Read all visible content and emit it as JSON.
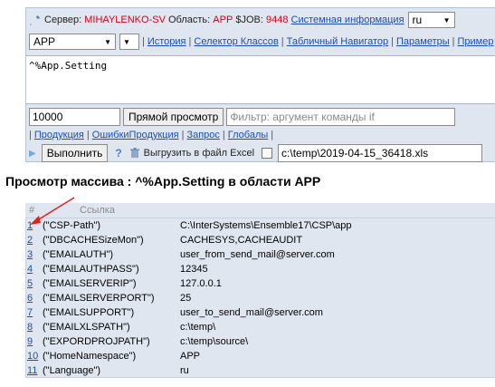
{
  "header": {
    "server_label": "Сервер:",
    "server_value": "MIHAYLENKO-SV",
    "area_label": "Область:",
    "area_value": "APP",
    "job_label": "$JOB:",
    "job_value": "9448",
    "sysinfo_link": "Системная информация",
    "lang_value": "ru"
  },
  "nav": {
    "namespace_value": "APP",
    "sep": "|",
    "links": [
      "История",
      "Селектор Классов",
      "Табличный Навигатор",
      "Параметры",
      "Пример"
    ]
  },
  "code": {
    "text": "^%App.Setting"
  },
  "controls": {
    "count_value": "10000",
    "direct_view_label": "Прямой просмотр",
    "filter_placeholder": "Фильтр: аргумент команды if"
  },
  "links2": [
    "Продукция",
    "ОшибкиПродукция",
    "Запрос",
    "Глобалы"
  ],
  "exec": {
    "execute_label": "Выполнить",
    "help_glyph": "?",
    "export_label": "Выгрузить в файл Excel",
    "file_path": "c:\\temp\\2019-04-15_36418.xls"
  },
  "page": {
    "title": "Просмотр массива : ^%App.Setting в области APP"
  },
  "table": {
    "col_num": "#",
    "col_ref": "Ссылка",
    "rows": [
      {
        "n": "1",
        "key": "(\"CSP-Path\")",
        "val": "C:\\InterSystems\\Ensemble17\\CSP\\app"
      },
      {
        "n": "2",
        "key": "(\"DBCACHESizeMon\")",
        "val": "CACHESYS,CACHEAUDIT"
      },
      {
        "n": "3",
        "key": "(\"EMAILAUTH\")",
        "val": "user_from_send_mail@server.com"
      },
      {
        "n": "4",
        "key": "(\"EMAILAUTHPASS\")",
        "val": "12345"
      },
      {
        "n": "5",
        "key": "(\"EMAILSERVERIP\")",
        "val": "127.0.0.1"
      },
      {
        "n": "6",
        "key": "(\"EMAILSERVERPORT\")",
        "val": "25"
      },
      {
        "n": "7",
        "key": "(\"EMAILSUPPORT\")",
        "val": "user_to_send_mail@server.com"
      },
      {
        "n": "8",
        "key": "(\"EMAILXLSPATH\")",
        "val": "c:\\temp\\"
      },
      {
        "n": "9",
        "key": "(\"EXPORDPROJPATH\")",
        "val": "c:\\temp\\source\\"
      },
      {
        "n": "10",
        "key": "(\"HomeNamespace\")",
        "val": "APP"
      },
      {
        "n": "11",
        "key": "(\"Language\")",
        "val": "ru"
      }
    ]
  },
  "colors": {
    "panel_bg": "#dfe6ef",
    "link": "#1a4fb0",
    "highlight": "#d0021b",
    "annotation_arrow": "#e02020"
  }
}
